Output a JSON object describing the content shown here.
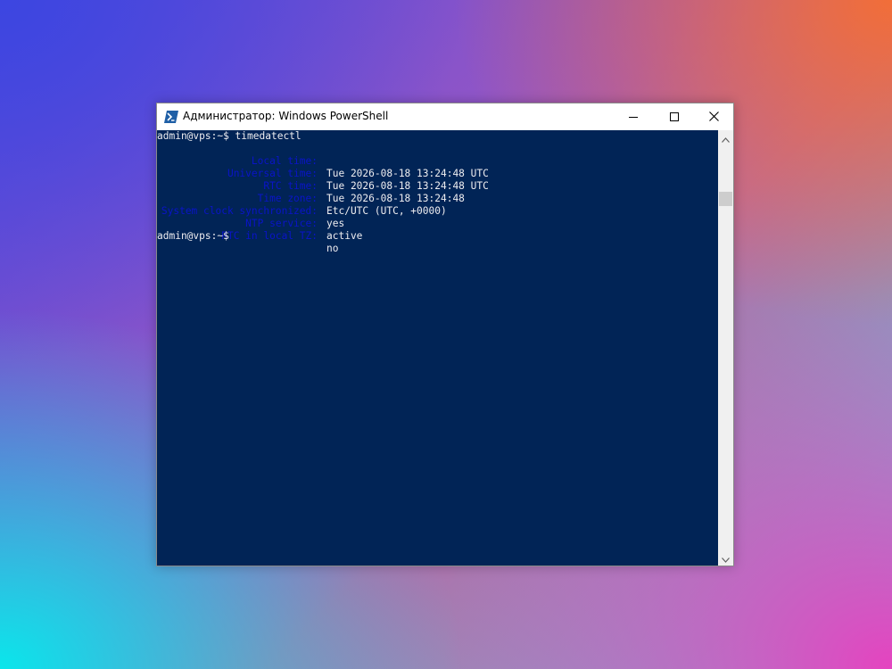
{
  "window": {
    "title": "Администратор: Windows PowerShell",
    "icon": "powershell-icon",
    "controls": [
      "minimize-icon",
      "maximize-icon",
      "close-icon"
    ]
  },
  "terminal": {
    "command_line": "admin@vps:~$ timedatectl",
    "rows": [
      {
        "label": "Local time:",
        "value": "Tue 2026-08-18 13:24:48 UTC"
      },
      {
        "label": "Universal time:",
        "value": "Tue 2026-08-18 13:24:48 UTC"
      },
      {
        "label": "RTC time:",
        "value": "Tue 2026-08-18 13:24:48"
      },
      {
        "label": "Time zone:",
        "value": "Etc/UTC (UTC, +0000)"
      },
      {
        "label": "System clock synchronized:",
        "value": "yes"
      },
      {
        "label": "NTP service:",
        "value": "active"
      },
      {
        "label": "RTC in local TZ:",
        "value": "no"
      }
    ],
    "prompt": "admin@vps:~$"
  },
  "colors": {
    "console_background": "#012456",
    "console_text": "#eeedf0",
    "label_text": "#0a14c8",
    "powershell_icon": "#1f5fa6"
  }
}
